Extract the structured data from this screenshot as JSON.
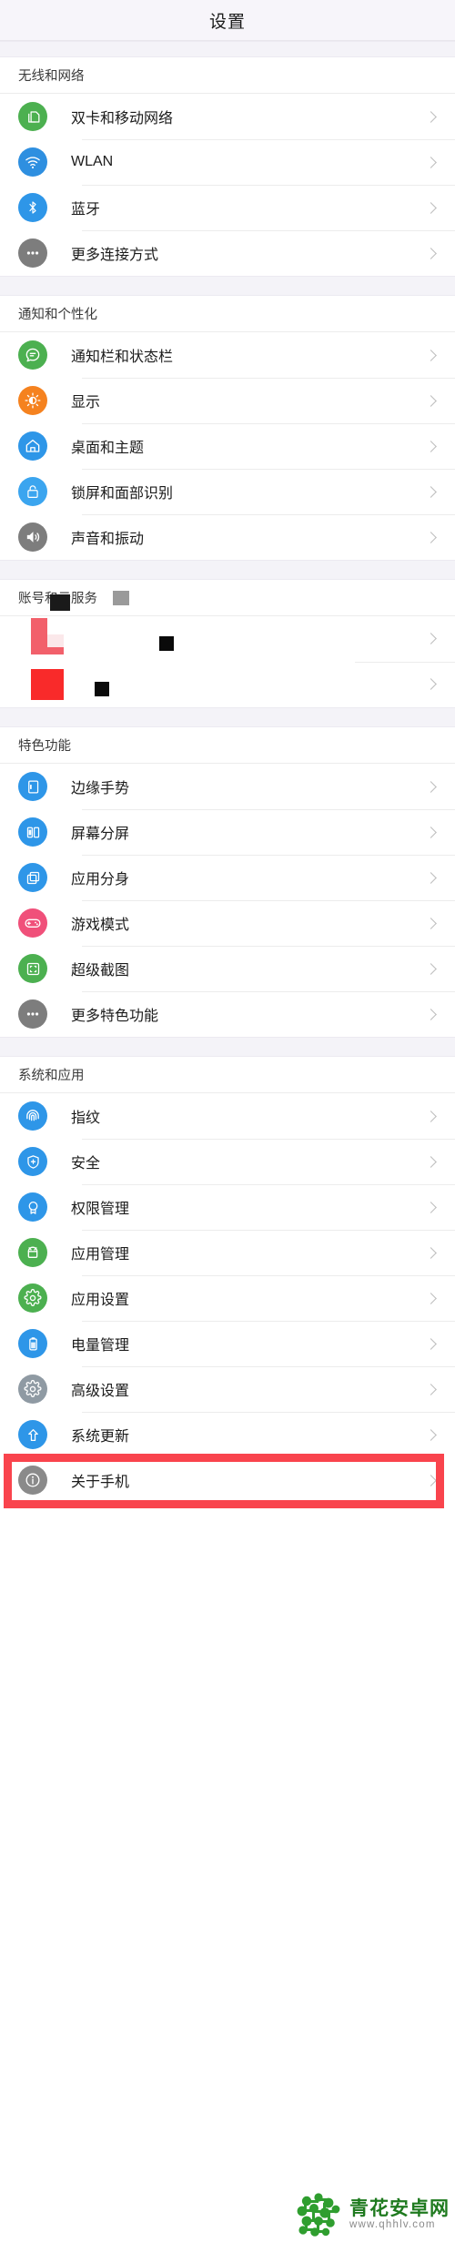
{
  "header": {
    "title": "设置"
  },
  "sections": [
    {
      "title": "无线和网络",
      "items": [
        {
          "label": "双卡和移动网络",
          "icon": "sim-card-icon",
          "color": "#4cb050"
        },
        {
          "label": "WLAN",
          "icon": "wifi-icon",
          "color": "#2e8fe0"
        },
        {
          "label": "蓝牙",
          "icon": "bluetooth-icon",
          "color": "#2e96e8"
        },
        {
          "label": "更多连接方式",
          "icon": "more-dots-icon",
          "color": "#7d7d7d"
        }
      ]
    },
    {
      "title": "通知和个性化",
      "items": [
        {
          "label": "通知栏和状态栏",
          "icon": "notification-bubble-icon",
          "color": "#4cb050"
        },
        {
          "label": "显示",
          "icon": "brightness-icon",
          "color": "#f5821f"
        },
        {
          "label": "桌面和主题",
          "icon": "home-icon",
          "color": "#2e96e8"
        },
        {
          "label": "锁屏和面部识别",
          "icon": "lock-icon",
          "color": "#3ba5ef"
        },
        {
          "label": "声音和振动",
          "icon": "speaker-icon",
          "color": "#7d7d7d"
        }
      ]
    },
    {
      "title": "账号和云服务",
      "glitched": true,
      "items": [
        {
          "label": "",
          "icon": "corrupted-icon",
          "color": "#f2606b"
        },
        {
          "label": "",
          "icon": "corrupted-icon",
          "color": "#f92a2a"
        }
      ]
    },
    {
      "title": "特色功能",
      "items": [
        {
          "label": "边缘手势",
          "icon": "edge-gesture-icon",
          "color": "#2e96e8"
        },
        {
          "label": "屏幕分屏",
          "icon": "split-screen-icon",
          "color": "#2e96e8"
        },
        {
          "label": "应用分身",
          "icon": "app-clone-icon",
          "color": "#2e96e8"
        },
        {
          "label": "游戏模式",
          "icon": "gamepad-icon",
          "color": "#f0507a"
        },
        {
          "label": "超级截图",
          "icon": "screenshot-icon",
          "color": "#4cb050"
        },
        {
          "label": "更多特色功能",
          "icon": "more-dots-icon",
          "color": "#7d7d7d"
        }
      ]
    },
    {
      "title": "系统和应用",
      "items": [
        {
          "label": "指纹",
          "icon": "fingerprint-icon",
          "color": "#2e96e8"
        },
        {
          "label": "安全",
          "icon": "shield-icon",
          "color": "#2e96e8"
        },
        {
          "label": "权限管理",
          "icon": "badge-icon",
          "color": "#2e96e8"
        },
        {
          "label": "应用管理",
          "icon": "android-icon",
          "color": "#4cb050"
        },
        {
          "label": "应用设置",
          "icon": "gear-icon",
          "color": "#4cb050"
        },
        {
          "label": "电量管理",
          "icon": "battery-icon",
          "color": "#2e96e8"
        },
        {
          "label": "高级设置",
          "icon": "gear-icon",
          "color": "#8f9aa3"
        },
        {
          "label": "系统更新",
          "icon": "up-arrow-icon",
          "color": "#2e96e8"
        },
        {
          "label": "关于手机",
          "icon": "info-icon",
          "color": "#8a8a8a",
          "highlighted": true
        }
      ]
    }
  ],
  "watermark": {
    "name": "青花安卓网",
    "url": "www.qhhlv.com",
    "logo_color": "#2f9e2f",
    "highlight_color": "#f9444d"
  }
}
